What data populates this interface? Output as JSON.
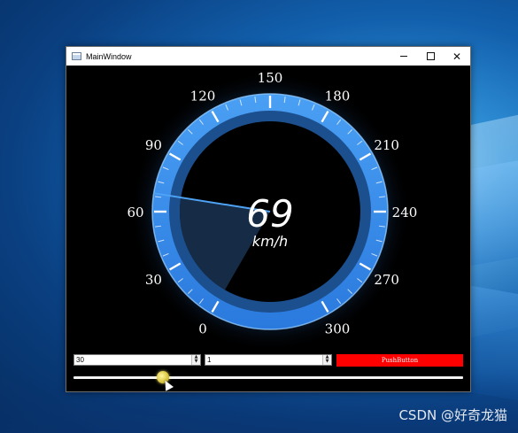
{
  "window": {
    "title": "MainWindow",
    "buttons": {
      "minimize": "minimize-icon",
      "maximize": "maximize-icon",
      "close": "✕"
    }
  },
  "gauge": {
    "value": 69,
    "value_text": "69",
    "unit": "km/h",
    "min": 0,
    "max": 300,
    "tick_labels": [
      "0",
      "30",
      "60",
      "90",
      "120",
      "150",
      "180",
      "210",
      "240",
      "270",
      "300"
    ],
    "colors": {
      "ring": "#2f86e8",
      "ring_edge": "#8ec9ff",
      "glow": "#1f5fae",
      "inner_ring": "#1c4f8e",
      "face": "#000000",
      "sweep": "#1a3251",
      "needle": "#4ea3f5",
      "text": "#ffffff"
    }
  },
  "controls": {
    "spinbox1_value": "30",
    "spinbox2_value": "1",
    "push_button_label": "PushButton",
    "push_button_color": "#ff0000",
    "slider_value": 69,
    "slider_min": 0,
    "slider_max": 300
  },
  "desktop": {
    "watermark": "CSDN @好奇龙猫"
  }
}
